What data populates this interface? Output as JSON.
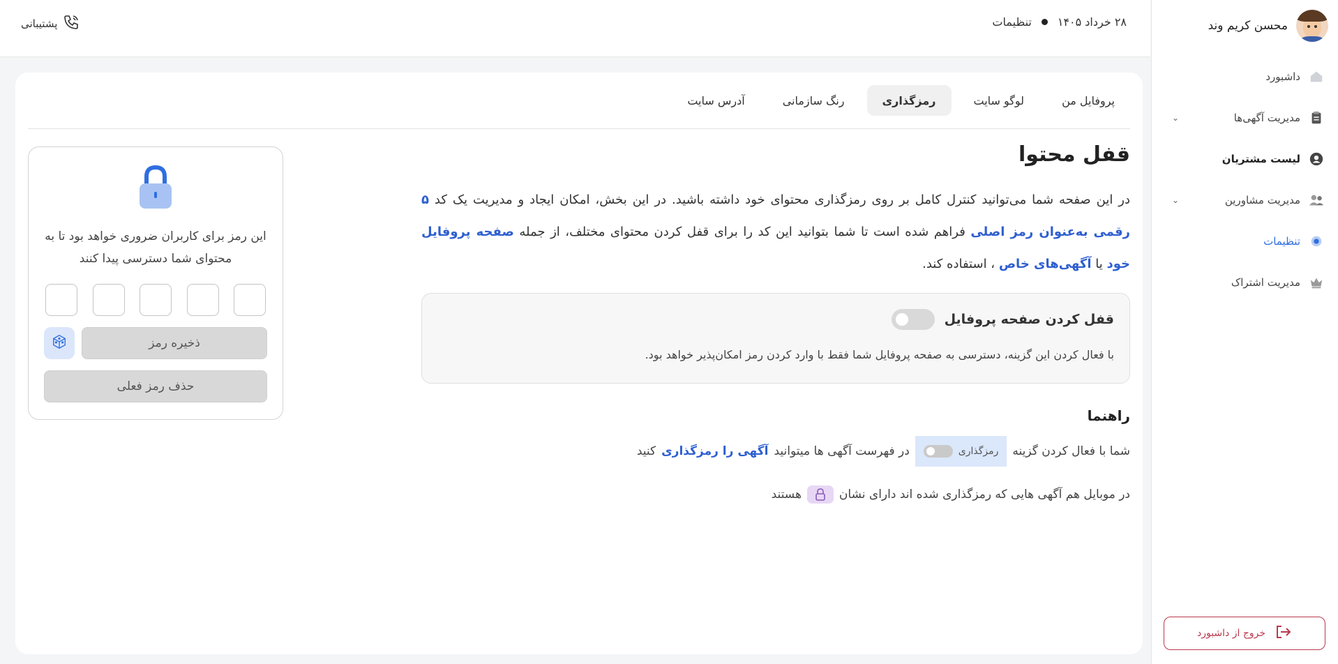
{
  "user": {
    "name": "محسن کریم وند"
  },
  "topbar": {
    "date": "۲۸ خرداد ۱۴۰۵",
    "section": "تنظیمات",
    "support_label": "پشتیبانی"
  },
  "sidebar": {
    "items": [
      {
        "label": "داشبورد",
        "icon": "home-icon"
      },
      {
        "label": "مدیریت آگهی‌ها",
        "icon": "clipboard-icon"
      },
      {
        "label": "لیست مشتریان",
        "icon": "user-circle-icon"
      },
      {
        "label": "مدیریت مشاورین",
        "icon": "users-icon"
      },
      {
        "label": "تنظیمات",
        "icon": "gear-icon"
      },
      {
        "label": "مدیریت اشتراک",
        "icon": "crown-icon"
      }
    ],
    "logout_label": "خروج از داشبورد"
  },
  "tabs": [
    {
      "label": "پروفایل من"
    },
    {
      "label": "لوگو سایت"
    },
    {
      "label": "رمزگذاری"
    },
    {
      "label": "رنگ سازمانی"
    },
    {
      "label": "آدرس سایت"
    }
  ],
  "main": {
    "title": "قفل محتوا",
    "desc": {
      "p1": "در این صفحه شما می‌توانید کنترل کامل بر روی رمزگذاری محتوای خود داشته باشید. در این بخش، امکان ایجاد و مدیریت یک کد",
      "h1": "۵ رقمی به‌عنوان رمز اصلی",
      "p2": "فراهم شده است تا شما بتوانید این کد را برای قفل کردن محتوای مختلف، از جمله",
      "h2": "صفحه پروفایل خود",
      "p3": "یا",
      "h3": "آگهی‌های خاص",
      "p4": "، استفاده کند."
    },
    "lock_box": {
      "title": "قفل کردن صفحه پروفایل",
      "subtitle": "با فعال کردن این گزینه، دسترسی به صفحه پروفایل شما فقط با وارد کردن رمز امکان‌پذیر خواهد بود."
    },
    "guide": {
      "title": "راهنما",
      "line1_a": "شما با فعال کردن گزینه",
      "pill_label": "رمزگذاری",
      "line1_b": "در فهرست آگهی ها میتوانید",
      "line1_hl": "آگهی را رمزگذاری",
      "line1_c": "کنید",
      "line2_a": "در موبایل هم آگهی هایی که رمزگذاری شده اند دارای نشان",
      "line2_b": "هستند"
    }
  },
  "password_panel": {
    "text": "این رمز برای کاربران ضروری خواهد بود تا به محتوای شما دسترسی پیدا کنند",
    "save_label": "ذخیره رمز",
    "delete_label": "حذف رمز فعلی"
  },
  "colors": {
    "accent": "#2f6ee0",
    "logout": "#b93a4e"
  }
}
